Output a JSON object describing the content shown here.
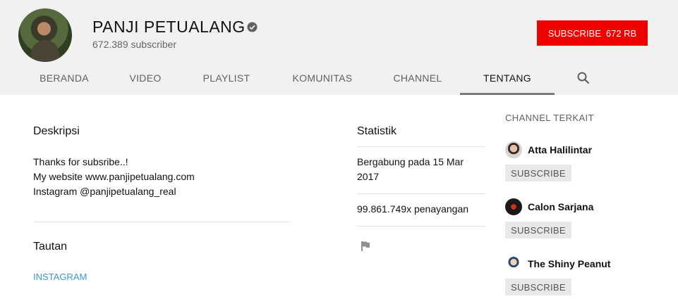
{
  "channel": {
    "name": "PANJI PETUALANG",
    "subscribers": "672.389 subscriber",
    "subscribe_label": "SUBSCRIBE",
    "subscribe_count": "672 RB"
  },
  "tabs": [
    {
      "label": "BERANDA"
    },
    {
      "label": "VIDEO"
    },
    {
      "label": "PLAYLIST"
    },
    {
      "label": "KOMUNITAS"
    },
    {
      "label": "CHANNEL"
    },
    {
      "label": "TENTANG"
    }
  ],
  "active_tab": "TENTANG",
  "description": {
    "heading": "Deskripsi",
    "text": "Thanks for subsribe..!\nMy website www.panjipetualang.com\nInstagram @panjipetualang_real"
  },
  "links": {
    "heading": "Tautan",
    "items": [
      {
        "label": "INSTAGRAM"
      }
    ]
  },
  "stats": {
    "heading": "Statistik",
    "joined": "Bergabung pada 15 Mar 2017",
    "views": "99.861.749x penayangan"
  },
  "related": {
    "heading": "CHANNEL TERKAIT",
    "channels": [
      {
        "name": "Atta Halilintar",
        "subscribe_label": "SUBSCRIBE"
      },
      {
        "name": "Calon Sarjana",
        "subscribe_label": "SUBSCRIBE"
      },
      {
        "name": "The Shiny Peanut",
        "subscribe_label": "SUBSCRIBE"
      }
    ]
  },
  "icons": {
    "verified": "verified-check-icon",
    "search": "search-icon",
    "flag": "flag-icon"
  },
  "colors": {
    "subscribe_red": "#ee0000",
    "link_blue": "#3d97d4",
    "header_bg": "#f1f1f1"
  }
}
